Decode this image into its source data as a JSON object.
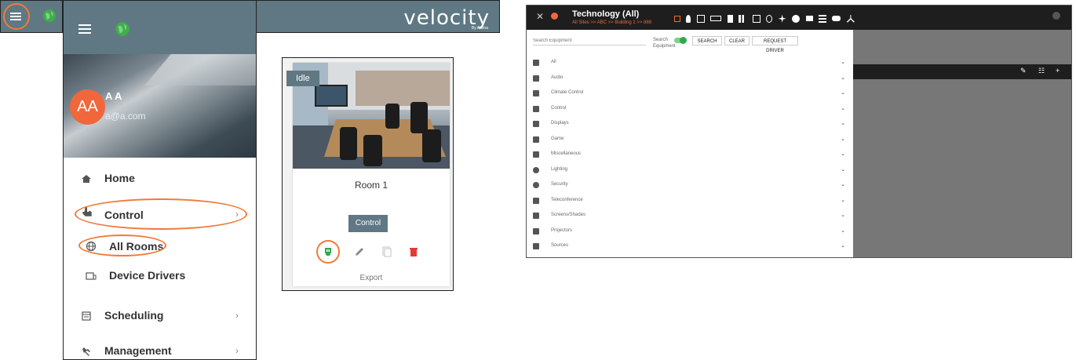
{
  "panel1": {
    "menu_icon": "hamburger-icon",
    "globe_icon": "globe-icon"
  },
  "drawer": {
    "logo_text": "velocity",
    "logo_sub": "By Atlona",
    "avatar_initials": "AA",
    "user_name": "A A",
    "user_email": "a@a.com",
    "nav": {
      "home": "Home",
      "control": "Control",
      "all_rooms": "All Rooms",
      "device_drivers": "Device Drivers",
      "scheduling": "Scheduling",
      "management": "Management"
    },
    "chevron": "›"
  },
  "room_card": {
    "status": "Idle",
    "name": "Room 1",
    "control_label": "Control",
    "export_label": "Export"
  },
  "equipment": {
    "title": "Technology (All)",
    "breadcrumb": "All Sites >> ABC >> Building 1 >> 888",
    "search_placeholder": "Search Equipment",
    "search_equipment_label": "Search\nEquipment",
    "search_label": "Search",
    "equipment_label": "Equipment",
    "buttons": {
      "search": "SEARCH",
      "clear": "CLEAR",
      "request_driver": "REQUEST DRIVER"
    },
    "categories": [
      {
        "label": "All",
        "icon": "grid-icon"
      },
      {
        "label": "Audio",
        "icon": "audio-bars-icon"
      },
      {
        "label": "Climate Control",
        "icon": "fan-icon"
      },
      {
        "label": "Control",
        "icon": "network-icon"
      },
      {
        "label": "Displays",
        "icon": "monitor-icon"
      },
      {
        "label": "Game",
        "icon": "gamepad-icon"
      },
      {
        "label": "Miscellaneous",
        "icon": "box-icon"
      },
      {
        "label": "Lighting",
        "icon": "bulb-icon"
      },
      {
        "label": "Security",
        "icon": "shield-icon"
      },
      {
        "label": "Teleconference",
        "icon": "camera-icon"
      },
      {
        "label": "Screens/Shades",
        "icon": "shades-icon"
      },
      {
        "label": "Projectors",
        "icon": "projector-icon"
      },
      {
        "label": "Sources",
        "icon": "source-icon"
      }
    ],
    "row_chevron": "⌄",
    "right_toolbar": {
      "edit": "✎",
      "settings": "☷",
      "add": "+"
    }
  },
  "colors": {
    "accent": "#f07a3a",
    "bar": "#5f7884",
    "green": "#2eaa4e",
    "delete": "#e53935"
  }
}
